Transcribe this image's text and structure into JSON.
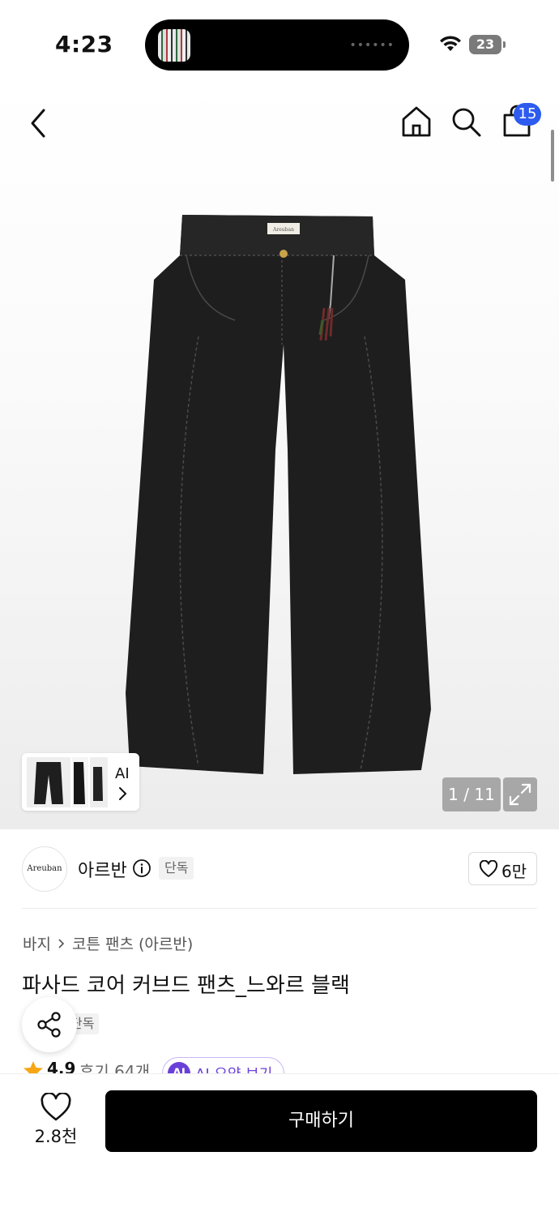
{
  "status_bar": {
    "time": "4:23",
    "battery": "23"
  },
  "header": {
    "cart_badge": "15"
  },
  "gallery": {
    "thumbnail_label": "AI",
    "page_counter": "1 / 11",
    "product_label": "Areuban"
  },
  "brand": {
    "logo_text": "Areuban",
    "name": "아르반",
    "exclusive_badge": "단독",
    "like_count": "6만"
  },
  "product": {
    "breadcrumb": [
      "바지",
      "코튼 팬츠 (아르반)"
    ],
    "title": "파사드 코어 커브드 팬츠_느와르 블랙",
    "exclusive_tag": "단독",
    "rating": "4.9",
    "review_count": "후기 64개",
    "ai_icon_label": "AI",
    "ai_summary_label": "AI 요약 보기"
  },
  "bottom_bar": {
    "wish_count": "2.8천",
    "buy_label": "구매하기"
  },
  "colors": {
    "accent_blue": "#2d5bef",
    "ai_purple": "#6a3fd9",
    "star": "#f7a614",
    "buy_button": "#000000"
  }
}
